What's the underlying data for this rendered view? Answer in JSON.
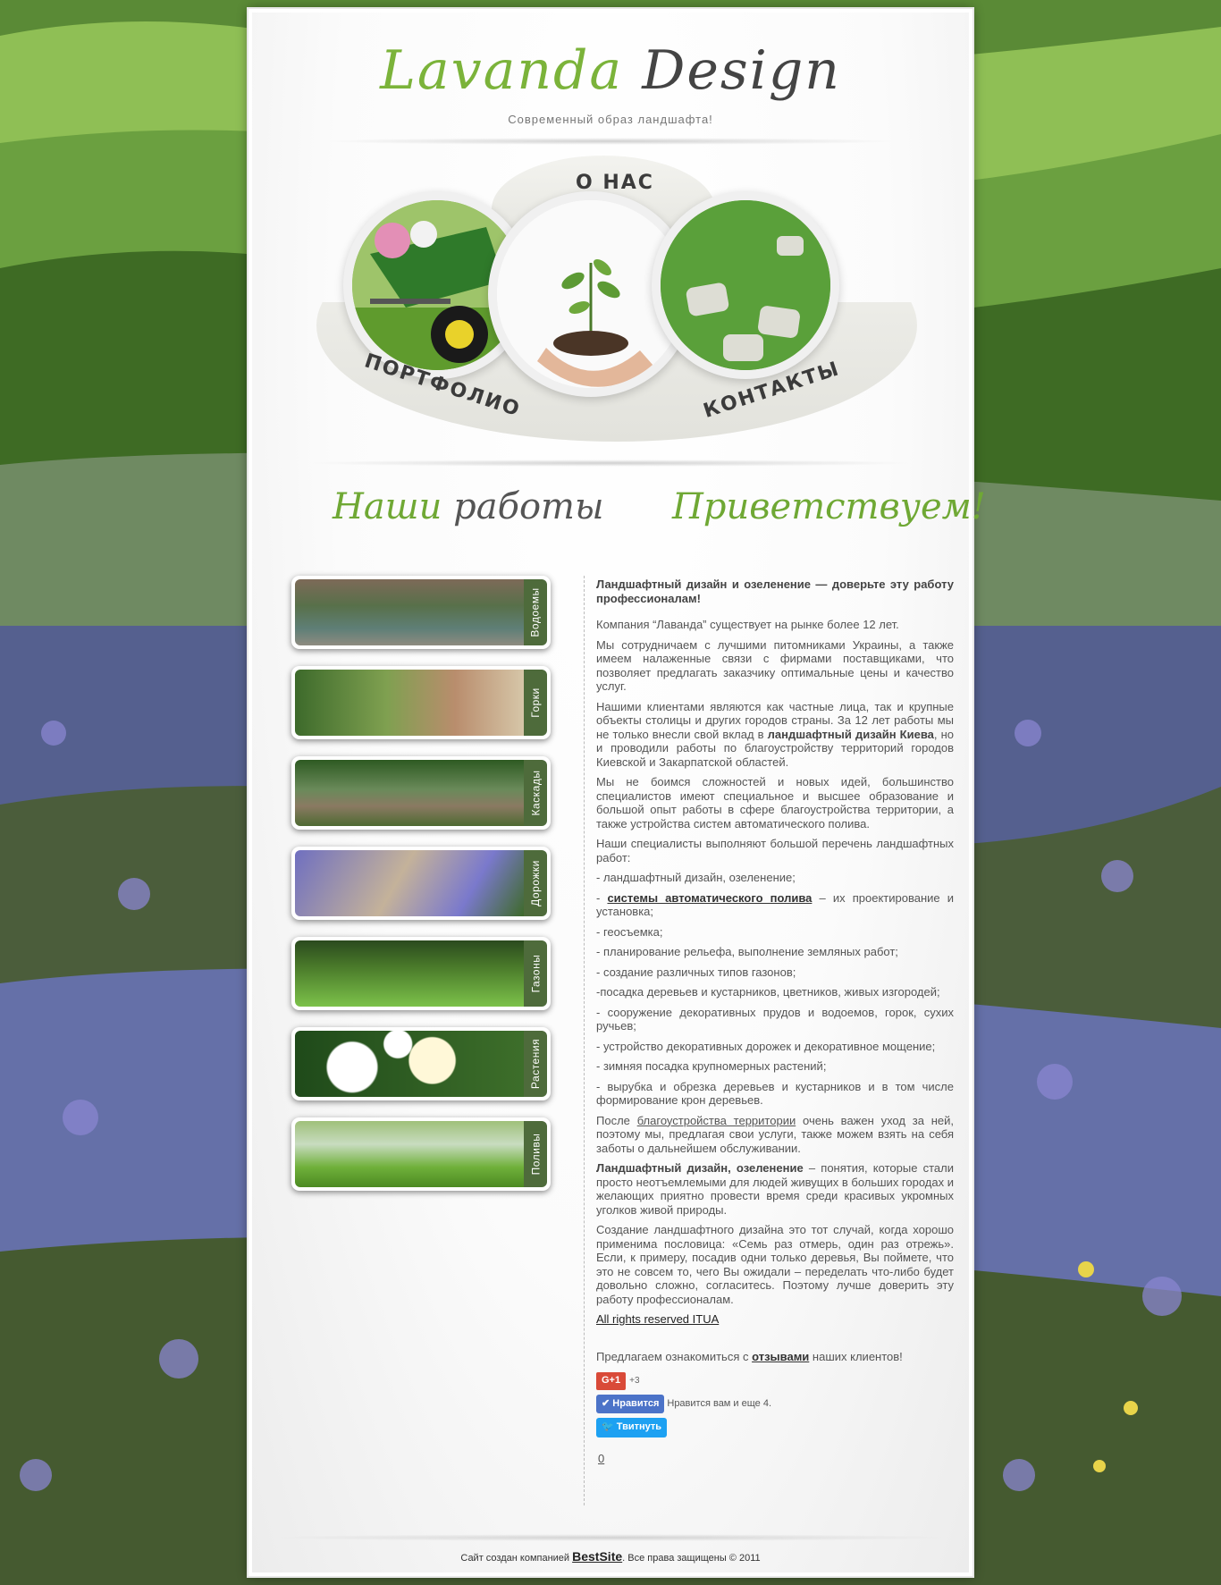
{
  "header": {
    "logo_word1": "Lavanda",
    "logo_word2": "Design",
    "tagline": "Современный образ ландшафта!"
  },
  "nav": {
    "about": "О НАС",
    "portfolio": "ПОРТФОЛИО",
    "contacts": "КОНТАКТЫ"
  },
  "headings": {
    "works_1": "Наши",
    "works_2": "работы",
    "welcome": "Приветствуем!"
  },
  "gallery": [
    {
      "label": "Водоемы"
    },
    {
      "label": "Горки"
    },
    {
      "label": "Каскады"
    },
    {
      "label": "Дорожки"
    },
    {
      "label": "Газоны"
    },
    {
      "label": "Растения"
    },
    {
      "label": "Поливы"
    }
  ],
  "content": {
    "title": "Ландшафтный дизайн и озеленение — доверьте эту работу профессионалам!",
    "p1": "Компания “Лаванда” существует на рынке более 12 лет.",
    "p2": "Мы сотрудничаем с лучшими питомниками Украины, а также имеем налаженные связи с фирмами поставщиками, что позволяет предлагать заказчику оптимальные цены и качество услуг.",
    "p3_a": "Нашими клиентами являются как частные лица, так и крупные объекты столицы и других городов страны. За 12 лет работы мы не только внесли свой вклад в ",
    "p3_b": "ландшафтный дизайн Киева",
    "p3_c": ", но и проводили работы по благоустройству территорий городов Киевской и Закарпатской областей.",
    "p4": "Мы не боимся сложностей и новых идей, большинство специалистов имеют специальное и высшее образование и большой опыт работы в сфере благоустройства территории, а также устройства систем автоматического полива.",
    "p5": "Наши специалисты выполняют большой перечень ландшафтных работ:",
    "l1": "- ландшафтный дизайн, озеленение;",
    "l2_a": "- ",
    "l2_link": "системы автоматического полива",
    "l2_b": " – их проектирование и установка;",
    "l3": "- геосъемка;",
    "l4": "- планирование рельефа, выполнение земляных работ;",
    "l5": "- создание различных типов газонов;",
    "l6": "-посадка деревьев и кустарников, цветников, живых изгородей;",
    "l7": "- сооружение декоративных прудов и водоемов, горок, сухих ручьев;",
    "l8": "- устройство декоративных дорожек и декоративное мощение;",
    "l9": "- зимняя посадка крупномерных растений;",
    "l10": "- вырубка и обрезка деревьев и кустарников и в том числе формирование крон деревьев.",
    "p6_a": "После ",
    "p6_link": "благоустройства территории",
    "p6_b": " очень важен уход за ней, поэтому мы, предлагая свои услуги, также можем взять на себя заботы о дальнейшем обслуживании.",
    "p7_b": "Ландшафтный дизайн, озеленение",
    "p7_c": " – понятия, которые стали просто неотъемлемыми для людей живущих в больших городах и желающих приятно провести время среди красивых укромных уголков живой природы.",
    "p8": "Создание ландшафтного дизайна это тот случай, когда хорошо применима пословица: «Семь раз отмерь, один раз отрежь». Если, к примеру, посадив одни только деревья, Вы поймете, что это не совсем то, чего Вы ожидали – переделать что-либо будет довольно сложно, согласитесь. Поэтому лучше доверить эту работу профессионалам.",
    "rights_link": "All rights reserved ITUA",
    "reviews_a": "Предлагаем ознакомиться с ",
    "reviews_link": "отзывами",
    "reviews_b": " наших клиентов!",
    "counter": "0"
  },
  "social": {
    "gplus": "G+1",
    "gplus_count": "+3",
    "fb_like": "Нравится",
    "fb_text": "Нравится вам и еще 4.",
    "tweet": "Твитнуть"
  },
  "footer": {
    "text_a": "Сайт создан компанией ",
    "brand": "BestSite",
    "text_b": ". Все права защищены © 2011"
  },
  "colors": {
    "accent_green": "#7bb33a",
    "tab_green": "#4e6b3b",
    "gplus_red": "#d94a38",
    "fb_blue": "#4c73c8",
    "twitter_blue": "#1da1f2"
  }
}
